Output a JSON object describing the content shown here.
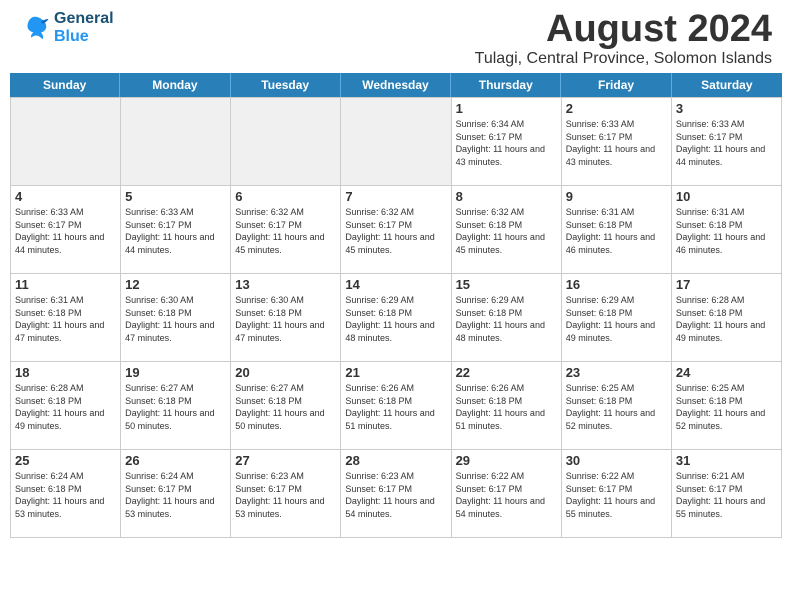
{
  "header": {
    "logo_line1": "General",
    "logo_line2": "Blue",
    "main_title": "August 2024",
    "subtitle": "Tulagi, Central Province, Solomon Islands"
  },
  "calendar": {
    "days_of_week": [
      "Sunday",
      "Monday",
      "Tuesday",
      "Wednesday",
      "Thursday",
      "Friday",
      "Saturday"
    ],
    "weeks": [
      [
        {
          "day": "",
          "empty": true
        },
        {
          "day": "",
          "empty": true
        },
        {
          "day": "",
          "empty": true
        },
        {
          "day": "",
          "empty": true
        },
        {
          "day": "1",
          "sunrise": "6:34 AM",
          "sunset": "6:17 PM",
          "daylight": "11 hours and 43 minutes."
        },
        {
          "day": "2",
          "sunrise": "6:33 AM",
          "sunset": "6:17 PM",
          "daylight": "11 hours and 43 minutes."
        },
        {
          "day": "3",
          "sunrise": "6:33 AM",
          "sunset": "6:17 PM",
          "daylight": "11 hours and 44 minutes."
        }
      ],
      [
        {
          "day": "4",
          "sunrise": "6:33 AM",
          "sunset": "6:17 PM",
          "daylight": "11 hours and 44 minutes."
        },
        {
          "day": "5",
          "sunrise": "6:33 AM",
          "sunset": "6:17 PM",
          "daylight": "11 hours and 44 minutes."
        },
        {
          "day": "6",
          "sunrise": "6:32 AM",
          "sunset": "6:17 PM",
          "daylight": "11 hours and 45 minutes."
        },
        {
          "day": "7",
          "sunrise": "6:32 AM",
          "sunset": "6:17 PM",
          "daylight": "11 hours and 45 minutes."
        },
        {
          "day": "8",
          "sunrise": "6:32 AM",
          "sunset": "6:18 PM",
          "daylight": "11 hours and 45 minutes."
        },
        {
          "day": "9",
          "sunrise": "6:31 AM",
          "sunset": "6:18 PM",
          "daylight": "11 hours and 46 minutes."
        },
        {
          "day": "10",
          "sunrise": "6:31 AM",
          "sunset": "6:18 PM",
          "daylight": "11 hours and 46 minutes."
        }
      ],
      [
        {
          "day": "11",
          "sunrise": "6:31 AM",
          "sunset": "6:18 PM",
          "daylight": "11 hours and 47 minutes."
        },
        {
          "day": "12",
          "sunrise": "6:30 AM",
          "sunset": "6:18 PM",
          "daylight": "11 hours and 47 minutes."
        },
        {
          "day": "13",
          "sunrise": "6:30 AM",
          "sunset": "6:18 PM",
          "daylight": "11 hours and 47 minutes."
        },
        {
          "day": "14",
          "sunrise": "6:29 AM",
          "sunset": "6:18 PM",
          "daylight": "11 hours and 48 minutes."
        },
        {
          "day": "15",
          "sunrise": "6:29 AM",
          "sunset": "6:18 PM",
          "daylight": "11 hours and 48 minutes."
        },
        {
          "day": "16",
          "sunrise": "6:29 AM",
          "sunset": "6:18 PM",
          "daylight": "11 hours and 49 minutes."
        },
        {
          "day": "17",
          "sunrise": "6:28 AM",
          "sunset": "6:18 PM",
          "daylight": "11 hours and 49 minutes."
        }
      ],
      [
        {
          "day": "18",
          "sunrise": "6:28 AM",
          "sunset": "6:18 PM",
          "daylight": "11 hours and 49 minutes."
        },
        {
          "day": "19",
          "sunrise": "6:27 AM",
          "sunset": "6:18 PM",
          "daylight": "11 hours and 50 minutes."
        },
        {
          "day": "20",
          "sunrise": "6:27 AM",
          "sunset": "6:18 PM",
          "daylight": "11 hours and 50 minutes."
        },
        {
          "day": "21",
          "sunrise": "6:26 AM",
          "sunset": "6:18 PM",
          "daylight": "11 hours and 51 minutes."
        },
        {
          "day": "22",
          "sunrise": "6:26 AM",
          "sunset": "6:18 PM",
          "daylight": "11 hours and 51 minutes."
        },
        {
          "day": "23",
          "sunrise": "6:25 AM",
          "sunset": "6:18 PM",
          "daylight": "11 hours and 52 minutes."
        },
        {
          "day": "24",
          "sunrise": "6:25 AM",
          "sunset": "6:18 PM",
          "daylight": "11 hours and 52 minutes."
        }
      ],
      [
        {
          "day": "25",
          "sunrise": "6:24 AM",
          "sunset": "6:18 PM",
          "daylight": "11 hours and 53 minutes."
        },
        {
          "day": "26",
          "sunrise": "6:24 AM",
          "sunset": "6:17 PM",
          "daylight": "11 hours and 53 minutes."
        },
        {
          "day": "27",
          "sunrise": "6:23 AM",
          "sunset": "6:17 PM",
          "daylight": "11 hours and 53 minutes."
        },
        {
          "day": "28",
          "sunrise": "6:23 AM",
          "sunset": "6:17 PM",
          "daylight": "11 hours and 54 minutes."
        },
        {
          "day": "29",
          "sunrise": "6:22 AM",
          "sunset": "6:17 PM",
          "daylight": "11 hours and 54 minutes."
        },
        {
          "day": "30",
          "sunrise": "6:22 AM",
          "sunset": "6:17 PM",
          "daylight": "11 hours and 55 minutes."
        },
        {
          "day": "31",
          "sunrise": "6:21 AM",
          "sunset": "6:17 PM",
          "daylight": "11 hours and 55 minutes."
        }
      ]
    ]
  }
}
